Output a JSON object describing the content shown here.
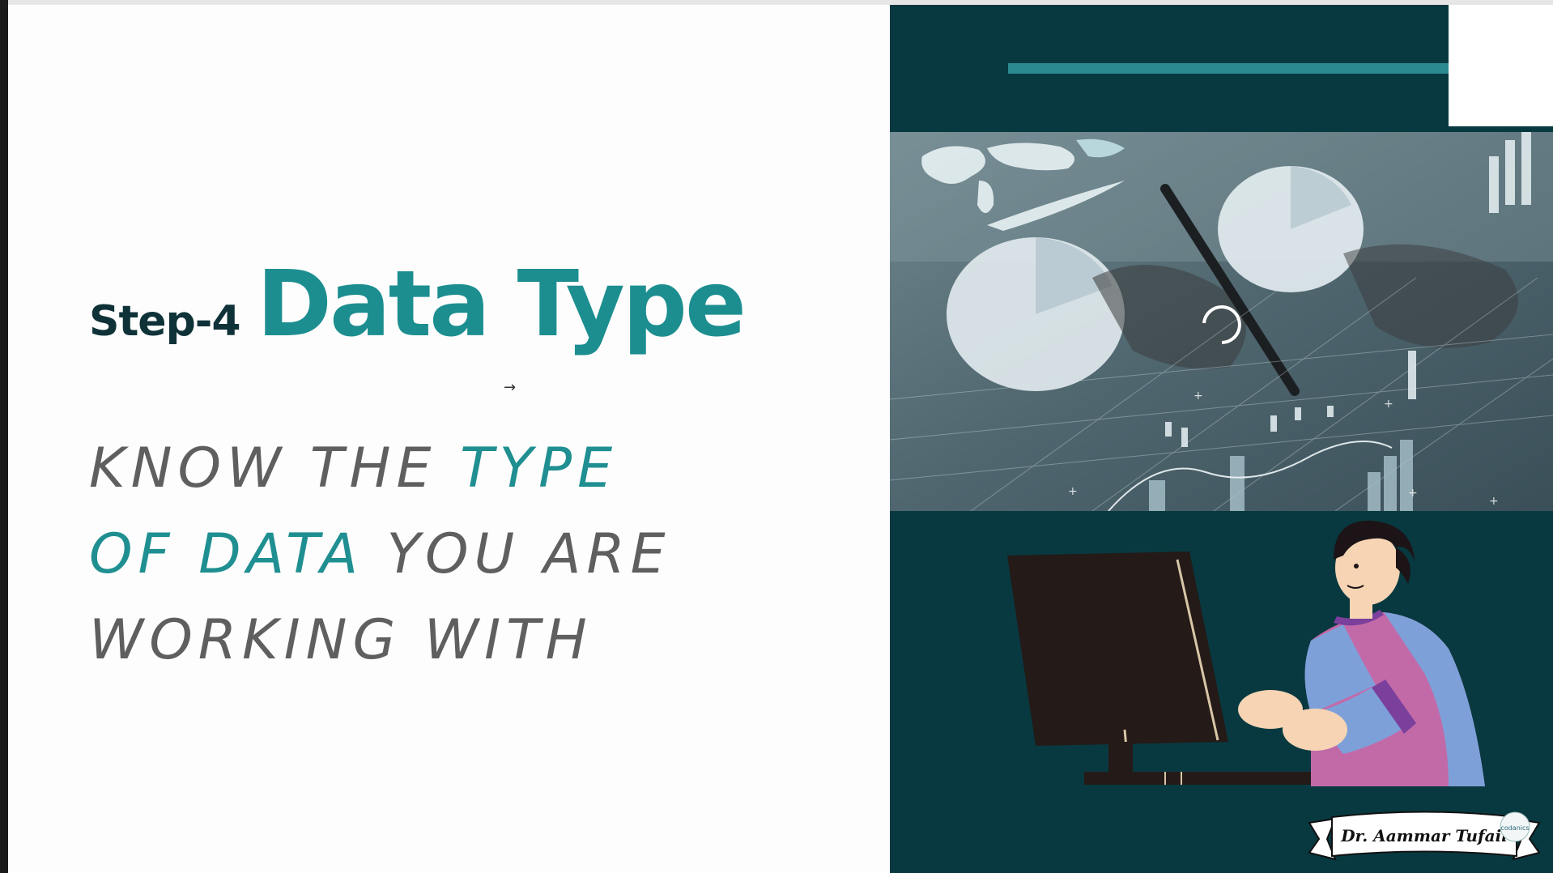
{
  "slide": {
    "step_label": "Step-4",
    "title": "Data Type",
    "subtitle_lines": [
      [
        {
          "text": "KNOW THE ",
          "accent": false
        },
        {
          "text": "TYPE",
          "accent": true
        }
      ],
      [
        {
          "text": "OF DATA",
          "accent": true
        },
        {
          "text": " YOU ARE",
          "accent": false
        }
      ],
      [
        {
          "text": "WORKING WITH",
          "accent": false
        }
      ]
    ],
    "cursor_glyph": "→",
    "signature": "Dr. Aammar Tufail",
    "logo_text": "codanics"
  },
  "colors": {
    "accent_teal": "#1c8e90",
    "dark_teal": "#083940",
    "title_dark": "#0f3238",
    "text_gray": "#5f5f5f"
  },
  "icons": {
    "photo": "business-analytics-image",
    "illustration": "person-at-computer-illustration",
    "cursor": "mouse-cursor-icon"
  }
}
